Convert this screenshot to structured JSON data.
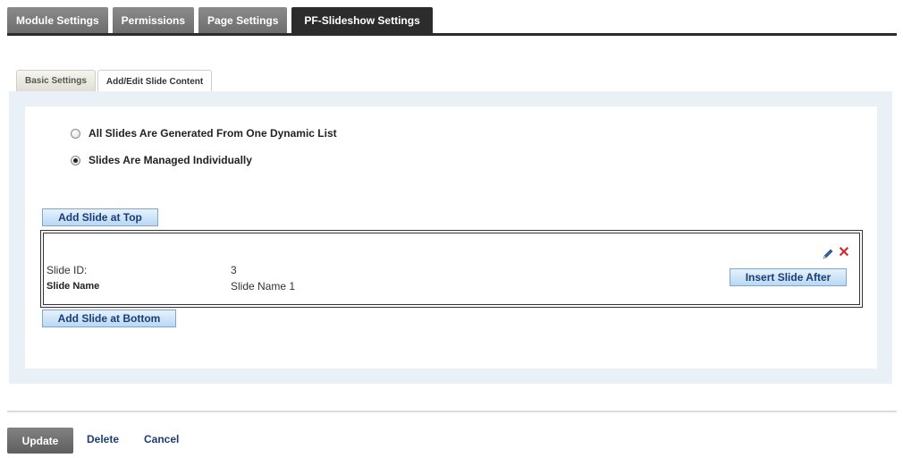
{
  "top_tabs": [
    "Module Settings",
    "Permissions",
    "Page Settings",
    "PF-Slideshow Settings"
  ],
  "sub_tabs": [
    "Basic Settings",
    "Add/Edit Slide Content"
  ],
  "options": {
    "dynamic_list": "All Slides Are Generated From One Dynamic List",
    "individually": "Slides Are Managed Individually",
    "selected": "individually"
  },
  "buttons": {
    "add_top": "Add Slide at Top",
    "add_bottom": "Add Slide at Bottom",
    "insert_after": "Insert Slide After"
  },
  "slide": {
    "id_label": "Slide ID:",
    "id_value": "3",
    "name_label": "Slide Name",
    "name_value": "Slide Name 1"
  },
  "icons": {
    "edit": "pencil-icon",
    "delete": "close-icon"
  },
  "footer": {
    "update": "Update",
    "delete": "Delete",
    "cancel": "Cancel"
  }
}
